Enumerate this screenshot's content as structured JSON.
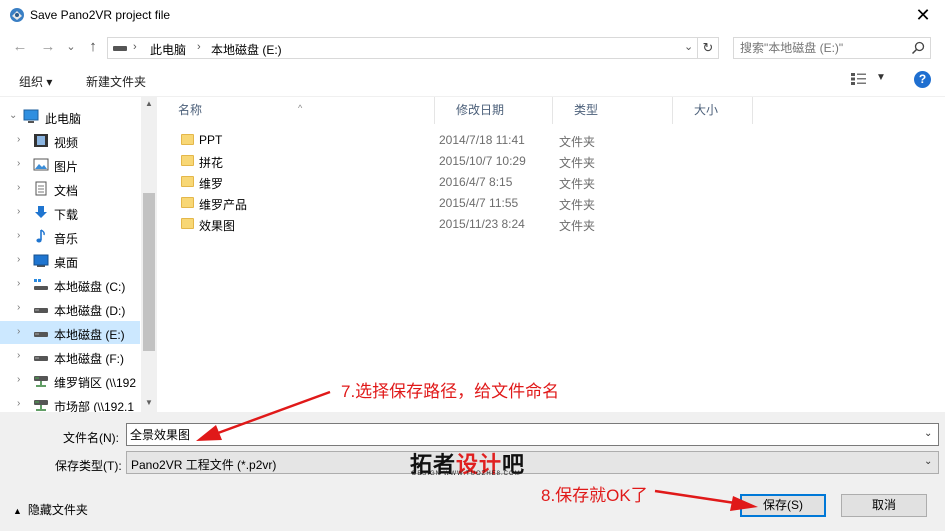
{
  "window": {
    "title": "Save Pano2VR project file",
    "close_glyph": "✕"
  },
  "nav": {
    "back_glyph": "←",
    "forward_glyph": "→",
    "recent_glyph": "⌄",
    "up_glyph": "↑",
    "breadcrumb_sep": "›",
    "breadcrumbs": [
      "此电脑",
      "本地磁盘 (E:)"
    ],
    "refresh_glyph": "↻",
    "search_placeholder": "搜索\"本地磁盘 (E:)\""
  },
  "toolbar": {
    "organize": "组织 ▾",
    "new_folder": "新建文件夹",
    "help": "?"
  },
  "tree": {
    "items": [
      {
        "label": "此电脑",
        "icon": "pc-icon"
      },
      {
        "label": "视频",
        "icon": "video-icon"
      },
      {
        "label": "图片",
        "icon": "pictures-icon"
      },
      {
        "label": "文档",
        "icon": "documents-icon"
      },
      {
        "label": "下载",
        "icon": "download-icon"
      },
      {
        "label": "音乐",
        "icon": "music-icon"
      },
      {
        "label": "桌面",
        "icon": "desktop-icon"
      },
      {
        "label": "本地磁盘 (C:)",
        "icon": "drive-icon"
      },
      {
        "label": "本地磁盘 (D:)",
        "icon": "drive-icon"
      },
      {
        "label": "本地磁盘 (E:)",
        "icon": "drive-icon"
      },
      {
        "label": "本地磁盘 (F:)",
        "icon": "drive-icon"
      },
      {
        "label": "维罗销区 (\\\\192",
        "icon": "network-drive-icon"
      },
      {
        "label": "市场部 (\\\\192.1",
        "icon": "network-drive-icon"
      }
    ],
    "selected_index": 9
  },
  "columns": [
    "名称",
    "修改日期",
    "类型",
    "大小"
  ],
  "files": [
    {
      "name": "PPT",
      "date": "2014/7/18 11:41",
      "type": "文件夹"
    },
    {
      "name": "拼花",
      "date": "2015/10/7 10:29",
      "type": "文件夹"
    },
    {
      "name": "维罗",
      "date": "2016/4/7 8:15",
      "type": "文件夹"
    },
    {
      "name": "维罗产品",
      "date": "2015/4/7 11:55",
      "type": "文件夹"
    },
    {
      "name": "效果图",
      "date": "2015/11/23 8:24",
      "type": "文件夹"
    }
  ],
  "form": {
    "filename_label": "文件名(N):",
    "filename_value": "全景效果图",
    "filetype_label": "保存类型(T):",
    "filetype_value": "Pano2VR 工程文件 (*.p2vr)",
    "hide_folders": "隐藏文件夹",
    "save_button": "保存(S)",
    "cancel_button": "取消"
  },
  "watermark": {
    "brand_a": "拓者",
    "brand_b": "设计",
    "brand_c": "吧",
    "sub": "DESIGN WWW.TUOZHE8.COM"
  },
  "annotations": {
    "step7": "7.选择保存路径，给文件命名",
    "step8": "8.保存就OK了"
  },
  "colors": {
    "accent": "#0078d7",
    "selection": "#cce8ff",
    "annotation": "#e01919",
    "folder": "#f8d775"
  }
}
